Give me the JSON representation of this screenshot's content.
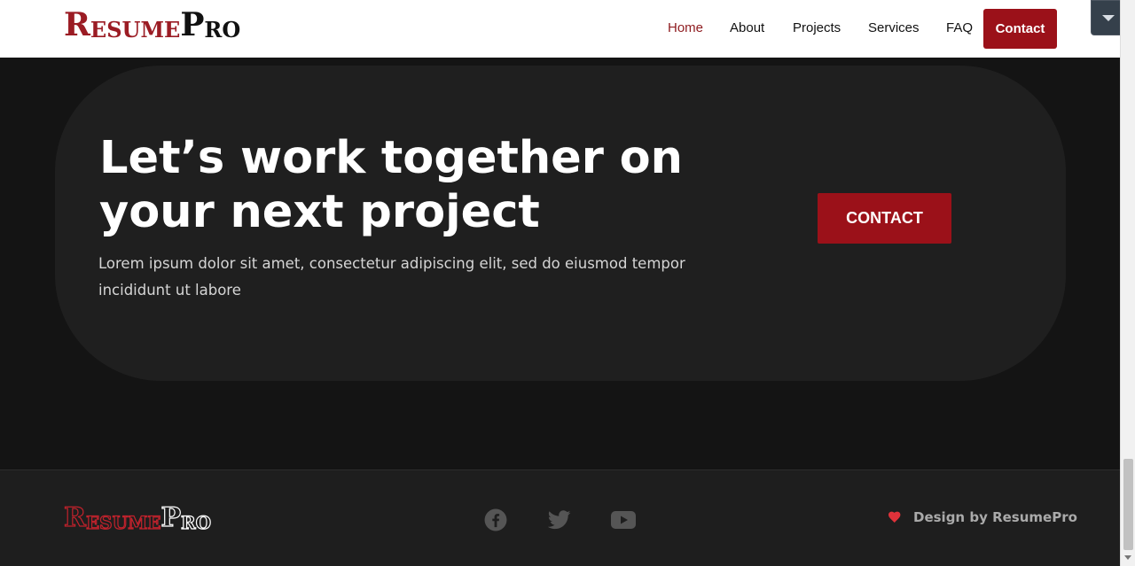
{
  "header": {
    "logo": {
      "first_letter": "R",
      "first_rest": "ESUME",
      "second_letter": "P",
      "second_rest": "RO"
    },
    "nav": [
      {
        "label": "Home",
        "active": true
      },
      {
        "label": "About"
      },
      {
        "label": "Projects"
      },
      {
        "label": "Services"
      },
      {
        "label": "FAQ"
      }
    ],
    "contact_label": "Contact"
  },
  "cta": {
    "title_line1": "Let’s work together on",
    "title_line2": "your next project",
    "text": "Lorem ipsum dolor sit amet, consectetur adipiscing elit, sed do eiusmod tempor incididunt ut labore",
    "button_label": "CONTACT"
  },
  "footer": {
    "logo": {
      "first_letter": "R",
      "first_rest": "ESUME",
      "second_letter": "P",
      "second_rest": "RO"
    },
    "social_icons": [
      "facebook-icon",
      "twitter-icon",
      "youtube-icon"
    ],
    "credit": "Design by ResumePro"
  },
  "colors": {
    "brand_red": "#9b1119",
    "dark_bg": "#141414",
    "card_bg": "#1f1f1f",
    "footer_bg": "#1e1e1e"
  }
}
